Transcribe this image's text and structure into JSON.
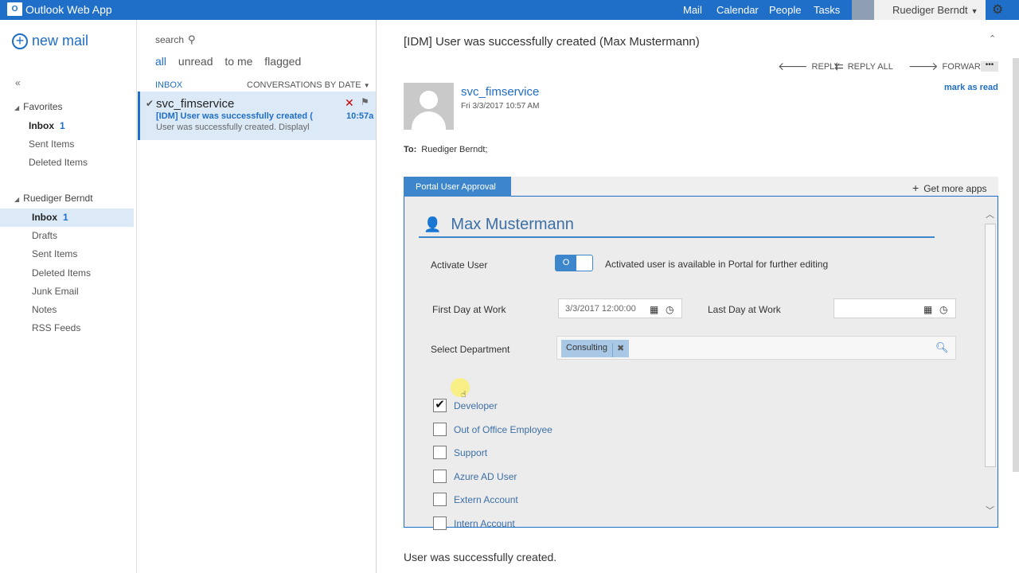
{
  "topbar": {
    "app_title": "Outlook Web App",
    "nav": [
      "Mail",
      "Calendar",
      "People",
      "Tasks"
    ],
    "user": "Ruediger Berndt",
    "logo_text": "O",
    "accent": "#1f6ec7"
  },
  "left": {
    "new_mail": "new mail",
    "collapse": "«",
    "favorites": {
      "title": "Favorites",
      "items": [
        {
          "label": "Inbox",
          "count": "1"
        },
        {
          "label": "Sent Items",
          "count": ""
        },
        {
          "label": "Deleted Items",
          "count": ""
        }
      ]
    },
    "account": {
      "title": "Ruediger Berndt",
      "items": [
        {
          "label": "Inbox",
          "count": "1"
        },
        {
          "label": "Drafts",
          "count": ""
        },
        {
          "label": "Sent Items",
          "count": ""
        },
        {
          "label": "Deleted Items",
          "count": ""
        },
        {
          "label": "Junk Email",
          "count": ""
        },
        {
          "label": "Notes",
          "count": ""
        },
        {
          "label": "RSS Feeds",
          "count": ""
        }
      ]
    }
  },
  "list": {
    "search_label": "search",
    "filters": [
      "all",
      "unread",
      "to me",
      "flagged"
    ],
    "folder": "INBOX",
    "sort": "CONVERSATIONS BY DATE",
    "message": {
      "from": "svc_fimservice",
      "subject": "[IDM] User was successfully created (",
      "preview": "User was successfully created. Displayl",
      "time": "10:57a"
    }
  },
  "read": {
    "subject": "[IDM] User was successfully created (Max Mustermann)",
    "actions": [
      "REPLY",
      "REPLY ALL",
      "FORWARD"
    ],
    "more": "•••",
    "mark_as_read": "mark as read",
    "sender": "svc_fimservice",
    "date": "Fri 3/3/2017 10:57 AM",
    "to_label": "To:",
    "to": "Ruediger Berndt;",
    "body": "User was successfully created."
  },
  "addin": {
    "tab": "Portal User Approval",
    "get_more": "Get more apps",
    "user_name": "Max Mustermann",
    "activate_label": "Activate User",
    "toggle_text": "O",
    "activate_hint": "Activated user is available in Portal for further editing",
    "first_day_label": "First Day at Work",
    "first_day_value": "3/3/2017 12:00:00",
    "last_day_label": "Last Day at Work",
    "last_day_value": "",
    "department_label": "Select Department",
    "department_chip": "Consulting",
    "options": [
      {
        "label": "Developer",
        "checked": true
      },
      {
        "label": "Out of Office Employee",
        "checked": false
      },
      {
        "label": "Support",
        "checked": false
      },
      {
        "label": "Azure AD User",
        "checked": false
      },
      {
        "label": "Extern Account",
        "checked": false
      },
      {
        "label": "Intern Account",
        "checked": false
      }
    ]
  }
}
